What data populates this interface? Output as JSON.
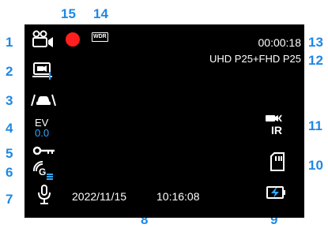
{
  "colors": {
    "callout": "#1e88e5",
    "screen_bg": "#000000",
    "text": "#ffffff",
    "ev_value": "#2ea8ff",
    "record_dot": "#ff1f1f"
  },
  "callouts": {
    "n1": "1",
    "n2": "2",
    "n3": "3",
    "n4": "4",
    "n5": "5",
    "n6": "6",
    "n7": "7",
    "n8": "8",
    "n9": "9",
    "n10": "10",
    "n11": "11",
    "n12": "12",
    "n13": "13",
    "n14": "14",
    "n15": "15"
  },
  "screen": {
    "timer": "00:00:18",
    "resolution": "UHD P25+FHD P25",
    "date": "2022/11/15",
    "time": "10:16:08",
    "ev_label": "EV",
    "ev_value": "0.0",
    "wdr_badge": "WDR",
    "ir_label": "IR"
  },
  "icons": [
    "dual-camera-icon",
    "video-screen-icon",
    "car-parking-icon",
    "exposure-value",
    "key-lock-icon",
    "gps-signal-icon",
    "microphone-icon",
    "recording-dot",
    "wdr-icon",
    "ir-camera-icon",
    "sd-card-icon",
    "battery-charging-icon"
  ]
}
